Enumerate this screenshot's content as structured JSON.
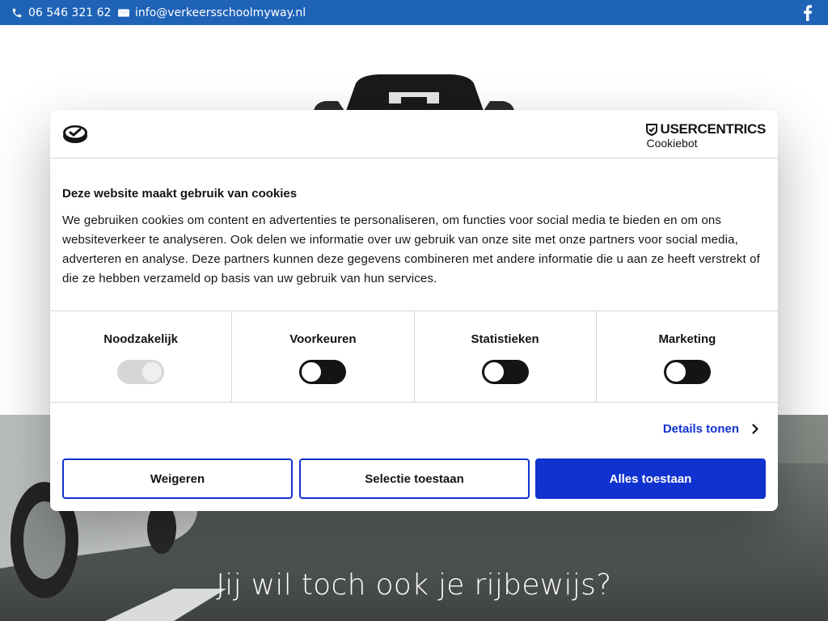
{
  "topbar": {
    "phone": "06 546 321 62",
    "email": "info@verkeersschoolmyway.nl",
    "background": "#1f63b7"
  },
  "hero": {
    "headline": "Jij wil toch ook je rijbewijs?"
  },
  "cookie_dialog": {
    "brand_name": "USERCENTRICS",
    "brand_product": "Cookiebot",
    "title": "Deze website maakt gebruik van cookies",
    "description": "We gebruiken cookies om content en advertenties te personaliseren, om functies voor social media te bieden en om ons websiteverkeer te analyseren. Ook delen we informatie over uw gebruik van onze site met onze partners voor social media, adverteren en analyse. Deze partners kunnen deze gegevens combineren met andere informatie die u aan ze heeft verstrekt of die ze hebben verzameld op basis van uw gebruik van hun services.",
    "categories": [
      {
        "label": "Noodzakelijk",
        "enabled": true,
        "locked": true
      },
      {
        "label": "Voorkeuren",
        "enabled": false,
        "locked": false
      },
      {
        "label": "Statistieken",
        "enabled": false,
        "locked": false
      },
      {
        "label": "Marketing",
        "enabled": false,
        "locked": false
      }
    ],
    "details_label": "Details tonen",
    "buttons": {
      "deny": "Weigeren",
      "selection": "Selectie toestaan",
      "allow_all": "Alles toestaan"
    },
    "accent_color": "#1032cf"
  }
}
